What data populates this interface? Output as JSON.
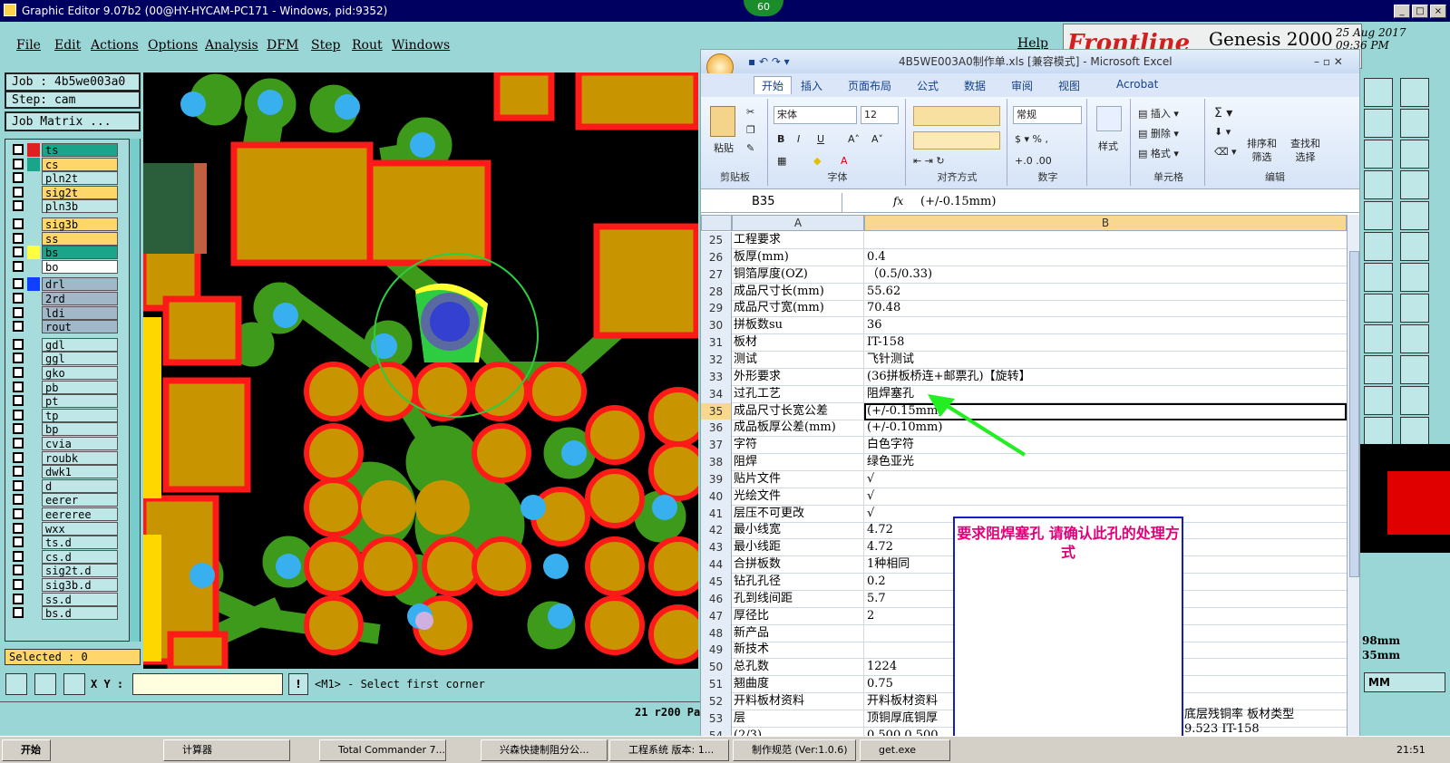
{
  "genesis": {
    "title": "Graphic Editor 9.07b2 (00@HY-HYCAM-PC171 - Windows, pid:9352)",
    "counter_badge": "60",
    "menu": [
      "File",
      "Edit",
      "Actions",
      "Options",
      "Analysis",
      "DFM",
      "Step",
      "Rout",
      "Windows"
    ],
    "help": "Help",
    "brand": "Frontline",
    "product": "Genesis 2000",
    "date": "25 Aug 2017",
    "time": "09:36 PM",
    "job": "Job  : 4b5we003a0",
    "step": "Step: cam",
    "job_matrix": "Job Matrix ...",
    "layers": [
      {
        "name": "ts",
        "color": "#e02020",
        "bg": "#1aa58a"
      },
      {
        "name": "cs",
        "color": "#1aa58a",
        "bg": "#ffd66a"
      },
      {
        "name": "pln2t",
        "color": "",
        "bg": "#bfe7e7"
      },
      {
        "name": "sig2t",
        "color": "",
        "bg": "#ffd66a"
      },
      {
        "name": "pln3b",
        "color": "",
        "bg": "#bfe7e7"
      },
      {
        "name": "sig3b",
        "color": "",
        "bg": "#ffd66a"
      },
      {
        "name": "ss",
        "color": "",
        "bg": "#ffd66a"
      },
      {
        "name": "bs",
        "color": "#ffff40",
        "bg": "#1aa58a"
      },
      {
        "name": "bo",
        "color": "",
        "bg": "#ffffff"
      },
      {
        "name": "drl",
        "color": "#1040ff",
        "bg": "#a0b8c8"
      },
      {
        "name": "2rd",
        "color": "",
        "bg": "#a0b8c8"
      },
      {
        "name": "ldi",
        "color": "",
        "bg": "#a0b8c8"
      },
      {
        "name": "rout",
        "color": "",
        "bg": "#a0b8c8"
      },
      {
        "name": "gdl",
        "color": "",
        "bg": "#bfe7e7"
      },
      {
        "name": "ggl",
        "color": "",
        "bg": "#bfe7e7"
      },
      {
        "name": "gko",
        "color": "",
        "bg": "#bfe7e7"
      },
      {
        "name": "pb",
        "color": "",
        "bg": "#bfe7e7"
      },
      {
        "name": "pt",
        "color": "",
        "bg": "#bfe7e7"
      },
      {
        "name": "tp",
        "color": "",
        "bg": "#bfe7e7"
      },
      {
        "name": "bp",
        "color": "",
        "bg": "#bfe7e7"
      },
      {
        "name": "cvia",
        "color": "",
        "bg": "#bfe7e7"
      },
      {
        "name": "roubk",
        "color": "",
        "bg": "#bfe7e7"
      },
      {
        "name": "dwk1",
        "color": "",
        "bg": "#bfe7e7"
      },
      {
        "name": "d",
        "color": "",
        "bg": "#bfe7e7"
      },
      {
        "name": "eerer",
        "color": "",
        "bg": "#bfe7e7"
      },
      {
        "name": "eereree",
        "color": "",
        "bg": "#bfe7e7"
      },
      {
        "name": "wxx",
        "color": "",
        "bg": "#bfe7e7"
      },
      {
        "name": "ts.d",
        "color": "",
        "bg": "#bfe7e7"
      },
      {
        "name": "cs.d",
        "color": "",
        "bg": "#bfe7e7"
      },
      {
        "name": "sig2t.d",
        "color": "",
        "bg": "#bfe7e7"
      },
      {
        "name": "sig3b.d",
        "color": "",
        "bg": "#bfe7e7"
      },
      {
        "name": "ss.d",
        "color": "",
        "bg": "#bfe7e7"
      },
      {
        "name": "bs.d",
        "color": "",
        "bg": "#bfe7e7"
      }
    ],
    "selected": "Selected : 0",
    "xy_label": "X Y :",
    "prompt": "<M1> - Select first corner",
    "status_text": "21 r200 Pa",
    "units": "MM",
    "dims": [
      "98mm",
      "35mm"
    ]
  },
  "excel": {
    "title": "4B5WE003A0制作单.xls  [兼容模式] - Microsoft Excel",
    "tabs": [
      "开始",
      "插入",
      "页面布局",
      "公式",
      "数据",
      "审阅",
      "视图",
      "Acrobat"
    ],
    "ribbon": {
      "paste": "粘贴",
      "clipboard": "剪贴板",
      "font_name": "宋体",
      "font_size": "12",
      "font_group": "字体",
      "align_group": "对齐方式",
      "number_format": "常规",
      "number_group": "数字",
      "style": "样式",
      "insert": "插入",
      "delete": "删除",
      "format": "格式",
      "cells_group": "单元格",
      "sort_filter": "排序和\n筛选",
      "find_select": "查找和\n选择",
      "edit_group": "编辑"
    },
    "name_box": "B35",
    "formula": "(+/-0.15mm)",
    "col_a": "A",
    "col_b": "B",
    "rows": [
      {
        "n": "25",
        "a": "工程要求",
        "b": ""
      },
      {
        "n": "26",
        "a": "板厚(mm)",
        "b": "0.4"
      },
      {
        "n": "27",
        "a": "铜箔厚度(OZ)",
        "b": "（0.5/0.33)"
      },
      {
        "n": "28",
        "a": "成品尺寸长(mm)",
        "b": "55.62"
      },
      {
        "n": "29",
        "a": "成品尺寸宽(mm)",
        "b": "70.48"
      },
      {
        "n": "30",
        "a": "拼板数su",
        "b": "36"
      },
      {
        "n": "31",
        "a": "板材",
        "b": "IT-158"
      },
      {
        "n": "32",
        "a": "测试",
        "b": "飞针测试"
      },
      {
        "n": "33",
        "a": "外形要求",
        "b": "(36拼板桥连+邮票孔)【旋转】"
      },
      {
        "n": "34",
        "a": "过孔工艺",
        "b": "阻焊塞孔"
      },
      {
        "n": "35",
        "a": "成品尺寸长宽公差",
        "b": "(+/-0.15mm)"
      },
      {
        "n": "36",
        "a": "成品板厚公差(mm)",
        "b": "(+/-0.10mm)"
      },
      {
        "n": "37",
        "a": "字符",
        "b": "白色字符"
      },
      {
        "n": "38",
        "a": "阻焊",
        "b": "绿色亚光"
      },
      {
        "n": "39",
        "a": "贴片文件",
        "b": "√"
      },
      {
        "n": "40",
        "a": "光绘文件",
        "b": "√"
      },
      {
        "n": "41",
        "a": "层压不可更改",
        "b": "√"
      },
      {
        "n": "42",
        "a": "最小线宽",
        "b": "4.72"
      },
      {
        "n": "43",
        "a": "最小线距",
        "b": "4.72"
      },
      {
        "n": "44",
        "a": "合拼板数",
        "b": "1种相同"
      },
      {
        "n": "45",
        "a": "钻孔孔径",
        "b": "0.2"
      },
      {
        "n": "46",
        "a": "孔到线间距",
        "b": "5.7"
      },
      {
        "n": "47",
        "a": "厚径比",
        "b": "2"
      },
      {
        "n": "48",
        "a": "新产品",
        "b": ""
      },
      {
        "n": "49",
        "a": "新技术",
        "b": ""
      },
      {
        "n": "50",
        "a": "总孔数",
        "b": "1224"
      },
      {
        "n": "51",
        "a": "翘曲度",
        "b": "0.75"
      },
      {
        "n": "52",
        "a": "开料板材资料",
        "b": "开料板材资料"
      },
      {
        "n": "53",
        "a": "层",
        "b": "顶铜厚底铜厚"
      },
      {
        "n": "54",
        "a": "(2/3)",
        "b": "0.500  0.500"
      }
    ],
    "extra_row53": "底层残铜率  板材类型",
    "extra_row54": "9.523        IT-158"
  },
  "note": "要求阻焊塞孔  请确认此孔的处理方式",
  "taskbar": {
    "start": "开始",
    "items": [
      "计算器",
      "Total Commander 7....",
      "兴森快捷制阻分公...",
      "工程系统  版本: 1...",
      "制作规范 (Ver:1.0.6)",
      "get.exe"
    ],
    "clock": "21:51"
  }
}
